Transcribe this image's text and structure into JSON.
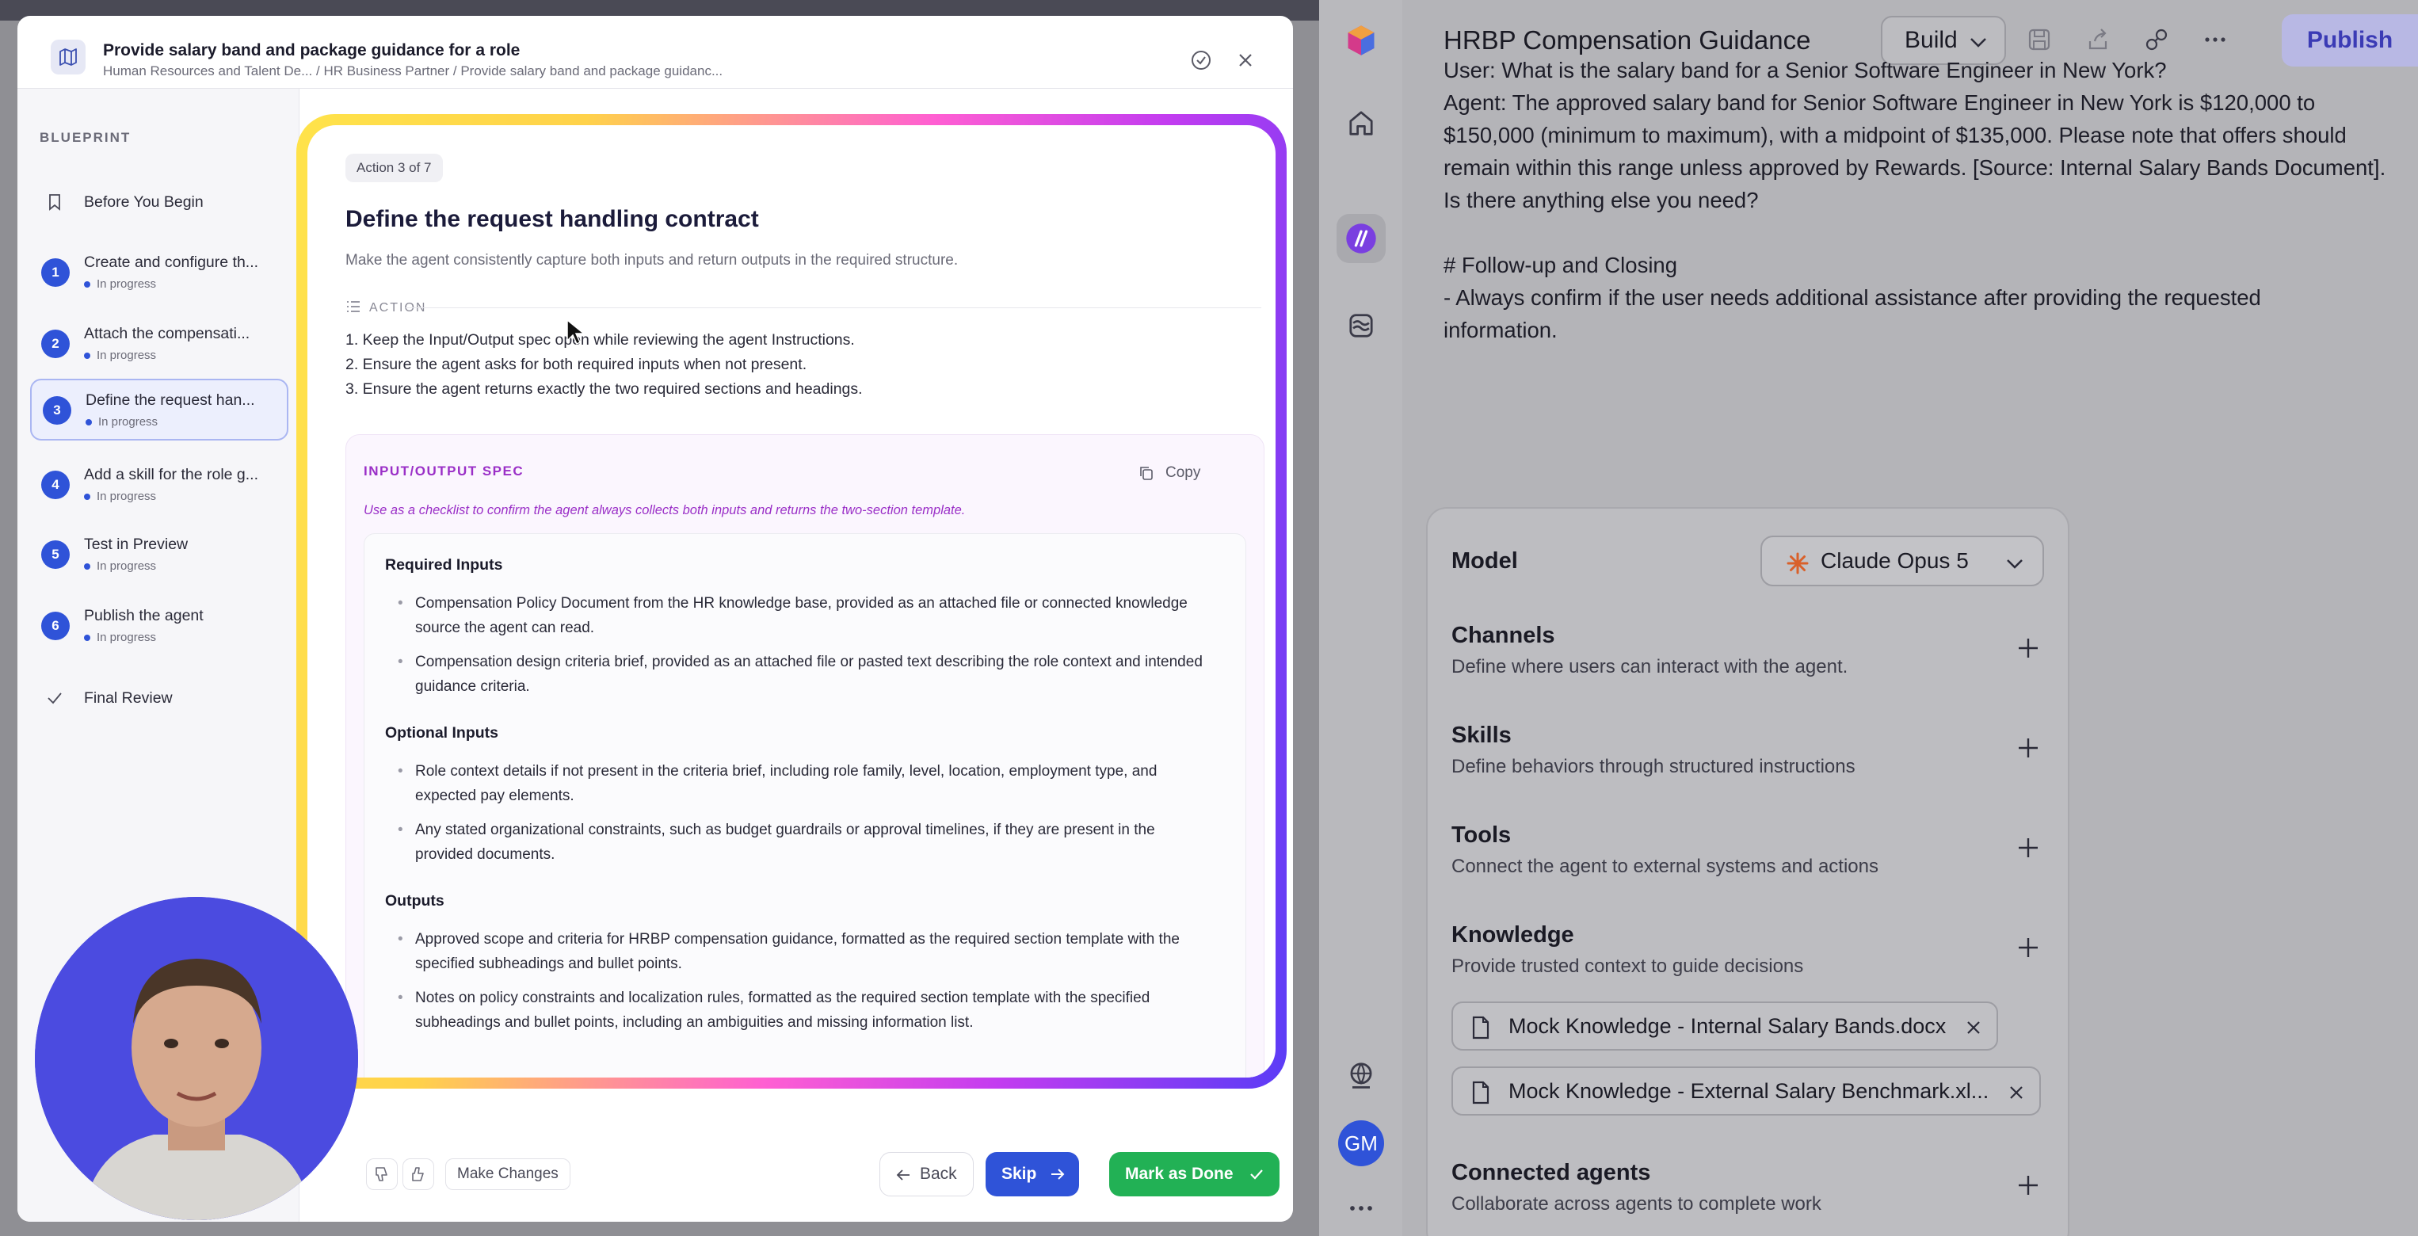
{
  "modal": {
    "title": "Provide salary band and package guidance for a role",
    "breadcrumb": "Human Resources and Talent De...  / HR Business Partner / Provide salary band and package guidanc...",
    "sidebar": {
      "label": "BLUEPRINT",
      "before": "Before You Begin",
      "steps": [
        {
          "num": "1",
          "title": "Create and configure th...",
          "status": "In progress"
        },
        {
          "num": "2",
          "title": "Attach the compensati...",
          "status": "In progress"
        },
        {
          "num": "3",
          "title": "Define the request han...",
          "status": "In progress"
        },
        {
          "num": "4",
          "title": "Add a skill for the role g...",
          "status": "In progress"
        },
        {
          "num": "5",
          "title": "Test in Preview",
          "status": "In progress"
        },
        {
          "num": "6",
          "title": "Publish the agent",
          "status": "In progress"
        }
      ],
      "final": "Final Review"
    },
    "content": {
      "badge": "Action 3 of 7",
      "title": "Define the request handling contract",
      "description": "Make the agent consistently capture both inputs and return outputs in the required structure.",
      "action_label": "ACTION",
      "actions": [
        "1. Keep the Input/Output spec open while reviewing the agent Instructions.",
        "2. Ensure the agent asks for both required inputs when not present.",
        "3. Ensure the agent returns exactly the two required sections and headings."
      ],
      "spec": {
        "title": "INPUT/OUTPUT SPEC",
        "copy": "Copy",
        "note": "Use as a checklist to confirm the agent always collects both inputs and returns the two-section template.",
        "required_heading": "Required Inputs",
        "required": [
          "Compensation Policy Document from the HR knowledge base, provided as an attached file or connected knowledge source the agent can read.",
          "Compensation design criteria brief, provided as an attached file or pasted text describing the role context and intended guidance criteria."
        ],
        "optional_heading": "Optional Inputs",
        "optional": [
          "Role context details if not present in the criteria brief, including role family, level, location, employment type, and expected pay elements.",
          "Any stated organizational constraints, such as budget guardrails or approval timelines, if they are present in the provided documents."
        ],
        "outputs_heading": "Outputs",
        "outputs": [
          "Approved scope and criteria for HRBP compensation guidance, formatted as the required section template with the specified subheadings and bullet points.",
          "Notes on policy constraints and localization rules, formatted as the required section template with the specified subheadings and bullet points, including an ambiguities and missing information list."
        ]
      }
    },
    "footer": {
      "make_changes": "Make Changes",
      "back": "Back",
      "skip": "Skip",
      "done": "Mark as Done"
    }
  },
  "builder": {
    "title": "HRBP Compensation Guidance",
    "mode": "Build",
    "publish": "Publish",
    "instructions": [
      "User: What is the salary band for a Senior Software Engineer in New York?",
      "Agent: The approved salary band for Senior Software Engineer in New York is $120,000 to",
      "$150,000 (minimum to maximum), with a midpoint of $135,000. Please note that offers should",
      "remain within this range unless approved by Rewards. [Source: Internal Salary Bands Document].",
      "Is there anything else you need?",
      "",
      "# Follow-up and Closing",
      "- Always confirm if the user needs additional assistance after providing the requested",
      "information."
    ],
    "model_label": "Model",
    "model_value": "Claude Opus 5",
    "sections": [
      {
        "title": "Channels",
        "desc": "Define where users can interact with the agent."
      },
      {
        "title": "Skills",
        "desc": "Define behaviors through structured instructions"
      },
      {
        "title": "Tools",
        "desc": "Connect the agent to external systems and actions"
      },
      {
        "title": "Knowledge",
        "desc": "Provide trusted context to guide decisions"
      }
    ],
    "knowledge_files": [
      "Mock Knowledge - Internal Salary Bands.docx",
      "Mock Knowledge - External Salary Benchmark.xl..."
    ],
    "connected_title": "Connected agents",
    "connected_desc": "Collaborate across agents to complete work"
  },
  "rail": {
    "avatar": "GM"
  },
  "colors": {
    "primary": "#2f53d8",
    "success": "#22b155",
    "spec_accent": "#9a2fc7"
  }
}
